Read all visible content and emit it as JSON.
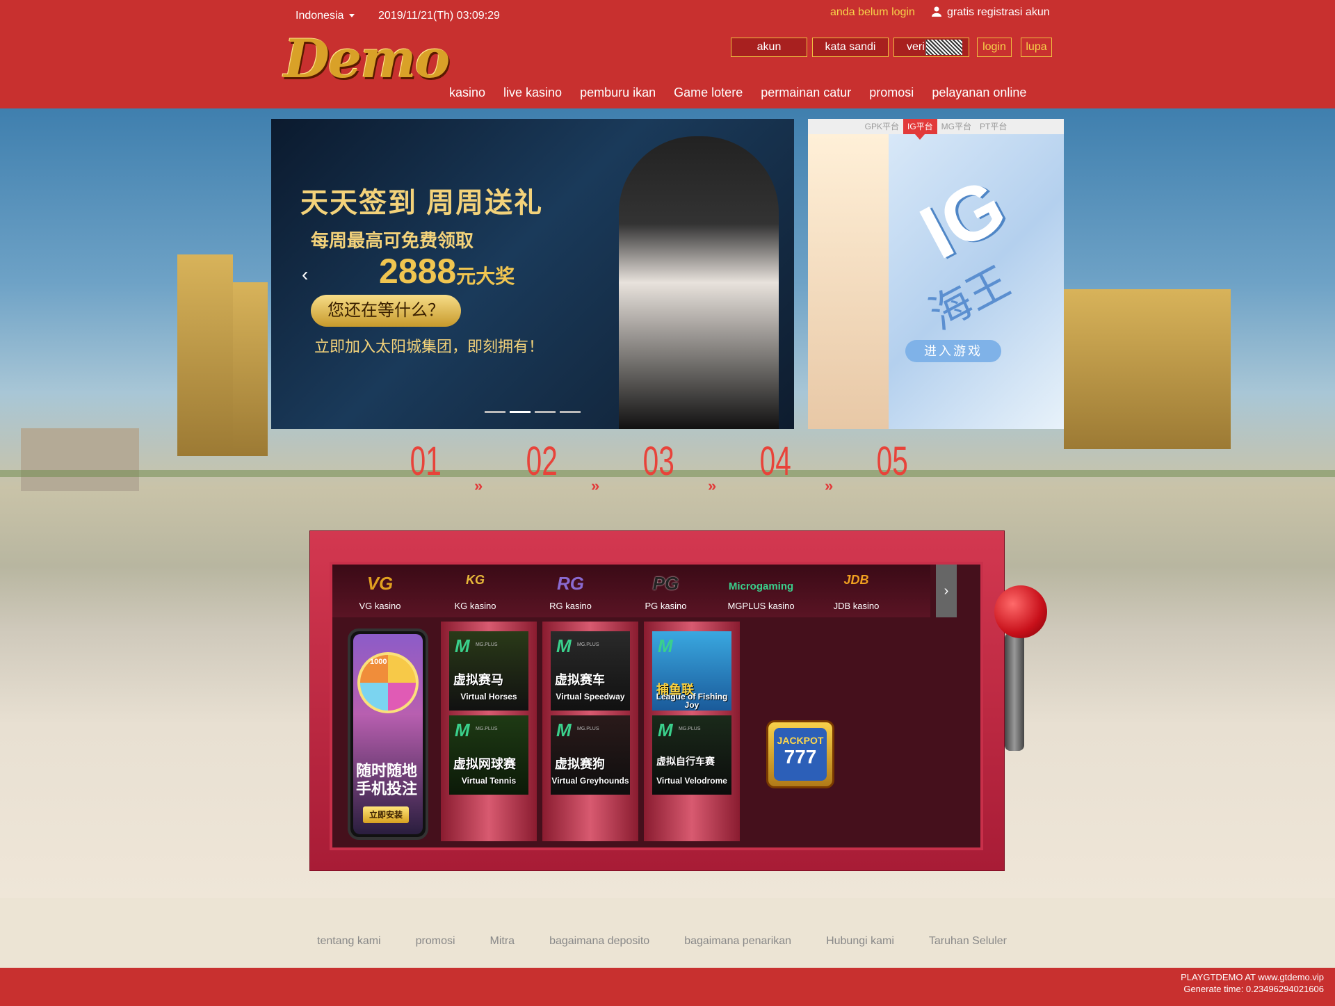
{
  "header": {
    "language": "Indonesia",
    "datetime": "2019/11/21(Th) 03:09:29",
    "not_logged_in": "anda belum login",
    "register": "gratis registrasi akun",
    "username_placeholder": "akun",
    "password_placeholder": "kata sandi",
    "captcha_placeholder": "veri",
    "login_label": "login",
    "forgot_label": "lupa",
    "logo": "Demo"
  },
  "nav": [
    "kasino",
    "live kasino",
    "pemburu ikan",
    "Game lotere",
    "permainan catur",
    "promosi",
    "pelayanan online"
  ],
  "banner": {
    "title": "天天签到 周周送礼",
    "subtitle": "每周最高可免费领取",
    "amount": "2888",
    "amount_suffix": "元大奖",
    "button": "您还在等什么？",
    "join_text": "立即加入太阳城集团，即刻拥有！",
    "active_slide": 2,
    "slide_count": 4
  },
  "platform_tabs": [
    "GPK平台",
    "IG平台",
    "MG平台",
    "PT平台"
  ],
  "platform_active": "IG平台",
  "platform_card": {
    "big": "IG",
    "sea": "海王",
    "enter": "进入游戏"
  },
  "steps": [
    "01",
    "02",
    "03",
    "04",
    "05"
  ],
  "providers": [
    {
      "logo": "VG",
      "name": "VG kasino",
      "color": "#e0a020"
    },
    {
      "logo": "KG",
      "name": "KG kasino",
      "color": "#e8b83a"
    },
    {
      "logo": "RG",
      "name": "RG kasino",
      "color": "#8a6ad0"
    },
    {
      "logo": "PG",
      "name": "PG kasino",
      "color": "#222222"
    },
    {
      "logo": "Microgaming",
      "name": "MGPLUS kasino",
      "color": "#3ad08c"
    },
    {
      "logo": "JDB",
      "name": "JDB kasino",
      "color": "#f0a020"
    }
  ],
  "phone": {
    "title": "随时随地\n手机投注",
    "button": "立即安装",
    "wheel_value": "1000"
  },
  "games": [
    {
      "cn": "虚拟赛马",
      "en": "Virtual Horses"
    },
    {
      "cn": "虚拟网球赛",
      "en": "Virtual Tennis"
    },
    {
      "cn": "虚拟赛车",
      "en": "Virtual Speedway"
    },
    {
      "cn": "虚拟赛狗",
      "en": "Virtual Greyhounds"
    },
    {
      "cn": "捕鱼联",
      "en": "League of Fishing Joy"
    },
    {
      "cn": "虚拟自行车赛",
      "en": "Virtual Velodrome"
    }
  ],
  "tile_brand": "MG.PLUS",
  "jackpot": {
    "word": "JACKPOT",
    "num": "777"
  },
  "footer_links": [
    "tentang kami",
    "promosi",
    "Mitra",
    "bagaimana deposito",
    "bagaimana penarikan",
    "Hubungi kami",
    "Taruhan Seluler"
  ],
  "copyright": {
    "line1": "PLAYGTDEMO AT www.gtdemo.vip",
    "line2": "Generate time: 0.23496294021606"
  },
  "colors": {
    "header_bg": "#c8302f",
    "accent_gold": "#f7d24a",
    "step_red": "#e8433a"
  }
}
